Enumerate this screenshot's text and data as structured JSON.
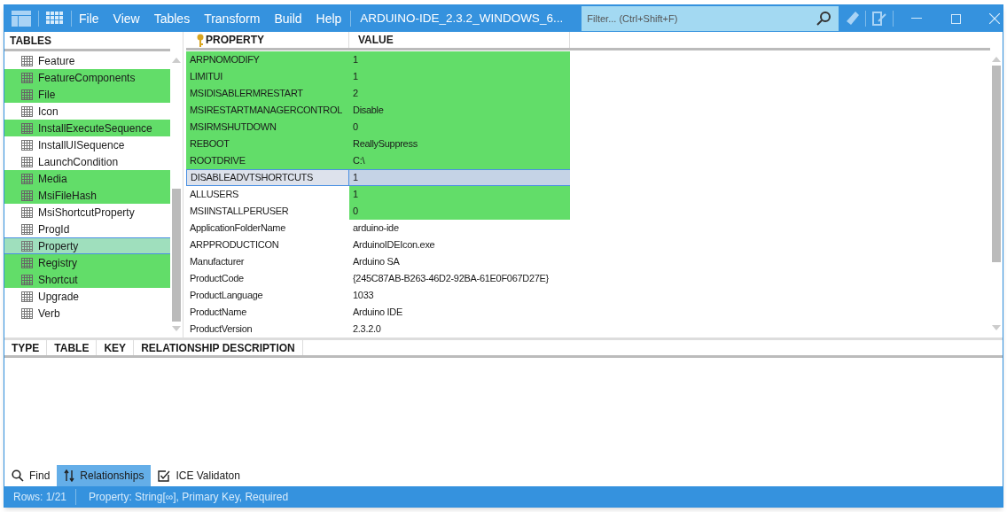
{
  "menu": [
    "File",
    "View",
    "Tables",
    "Transform",
    "Build",
    "Help"
  ],
  "window": {
    "title": "ARDUINO-IDE_2.3.2_WINDOWS_6..."
  },
  "filter": {
    "placeholder": "Filter... (Ctrl+Shift+F)"
  },
  "tables_header": "TABLES",
  "tables": [
    {
      "name": "Feature",
      "changed": false,
      "selected": false
    },
    {
      "name": "FeatureComponents",
      "changed": true,
      "selected": false
    },
    {
      "name": "File",
      "changed": true,
      "selected": false
    },
    {
      "name": "Icon",
      "changed": false,
      "selected": false
    },
    {
      "name": "InstallExecuteSequence",
      "changed": true,
      "selected": false
    },
    {
      "name": "InstallUISequence",
      "changed": false,
      "selected": false
    },
    {
      "name": "LaunchCondition",
      "changed": false,
      "selected": false
    },
    {
      "name": "Media",
      "changed": true,
      "selected": false
    },
    {
      "name": "MsiFileHash",
      "changed": true,
      "selected": false
    },
    {
      "name": "MsiShortcutProperty",
      "changed": false,
      "selected": false
    },
    {
      "name": "ProgId",
      "changed": false,
      "selected": false
    },
    {
      "name": "Property",
      "changed": false,
      "selected": true
    },
    {
      "name": "Registry",
      "changed": true,
      "selected": false
    },
    {
      "name": "Shortcut",
      "changed": true,
      "selected": false
    },
    {
      "name": "Upgrade",
      "changed": false,
      "selected": false
    },
    {
      "name": "Verb",
      "changed": false,
      "selected": false
    }
  ],
  "grid": {
    "columns": [
      "PROPERTY",
      "VALUE"
    ],
    "rows": [
      {
        "property": "ARPNOMODIFY",
        "value": "1",
        "property_changed": true,
        "value_changed": true,
        "selected": false
      },
      {
        "property": "LIMITUI",
        "value": "1",
        "property_changed": true,
        "value_changed": true,
        "selected": false
      },
      {
        "property": "MSIDISABLERMRESTART",
        "value": "2",
        "property_changed": true,
        "value_changed": true,
        "selected": false
      },
      {
        "property": "MSIRESTARTMANAGERCONTROL",
        "value": "Disable",
        "property_changed": true,
        "value_changed": true,
        "selected": false
      },
      {
        "property": "MSIRMSHUTDOWN",
        "value": "0",
        "property_changed": true,
        "value_changed": true,
        "selected": false
      },
      {
        "property": "REBOOT",
        "value": "ReallySuppress",
        "property_changed": true,
        "value_changed": true,
        "selected": false
      },
      {
        "property": "ROOTDRIVE",
        "value": "C:\\",
        "property_changed": true,
        "value_changed": true,
        "selected": false
      },
      {
        "property": "DISABLEADVTSHORTCUTS",
        "value": "1",
        "selected": true
      },
      {
        "property": "ALLUSERS",
        "value": "1",
        "property_changed": false,
        "value_changed": true,
        "selected": false
      },
      {
        "property": "MSIINSTALLPERUSER",
        "value": "0",
        "property_changed": false,
        "value_changed": true,
        "selected": false
      },
      {
        "property": "ApplicationFolderName",
        "value": "arduino-ide",
        "property_changed": false,
        "value_changed": false,
        "selected": false
      },
      {
        "property": "ARPPRODUCTICON",
        "value": "ArduinoIDEIcon.exe",
        "property_changed": false,
        "value_changed": false,
        "selected": false
      },
      {
        "property": "Manufacturer",
        "value": "Arduino SA",
        "property_changed": false,
        "value_changed": false,
        "selected": false
      },
      {
        "property": "ProductCode",
        "value": "{245C87AB-B263-46D2-92BA-61E0F067D27E}",
        "property_changed": false,
        "value_changed": false,
        "selected": false
      },
      {
        "property": "ProductLanguage",
        "value": "1033",
        "property_changed": false,
        "value_changed": false,
        "selected": false
      },
      {
        "property": "ProductName",
        "value": "Arduino IDE",
        "property_changed": false,
        "value_changed": false,
        "selected": false
      },
      {
        "property": "ProductVersion",
        "value": "2.3.2.0",
        "property_changed": false,
        "value_changed": false,
        "selected": false
      }
    ]
  },
  "relationships": {
    "columns": [
      "TYPE",
      "TABLE",
      "KEY",
      "RELATIONSHIP DESCRIPTION"
    ]
  },
  "bottom_tabs": [
    {
      "label": "Find",
      "kind": "find",
      "selected": false
    },
    {
      "label": "Relationships",
      "kind": "relationships",
      "selected": true
    },
    {
      "label": "ICE Validaton",
      "kind": "ice",
      "selected": false
    }
  ],
  "status_bar": {
    "rows": "Rows: 1/21",
    "info": "Property: String[∞], Primary Key, Required"
  }
}
